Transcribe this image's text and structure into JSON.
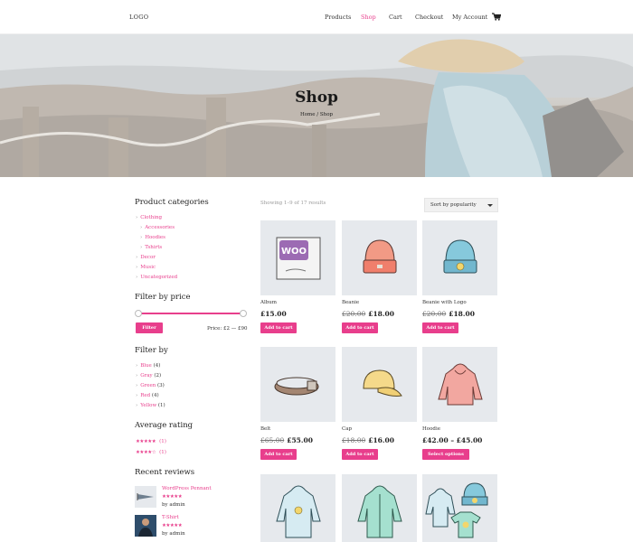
{
  "header": {
    "logo": "LOGO",
    "nav": [
      "Products",
      "Shop",
      "Cart",
      "Checkout",
      "My Account"
    ],
    "active_nav": "Shop",
    "cart_icon": "shopping-cart-icon"
  },
  "hero": {
    "title": "Shop",
    "breadcrumb": "Home / Shop"
  },
  "sidebar": {
    "categories_title": "Product categories",
    "categories": [
      {
        "label": "Clothing",
        "level": 0
      },
      {
        "label": "Accessories",
        "level": 1
      },
      {
        "label": "Hoodies",
        "level": 1
      },
      {
        "label": "Tshirts",
        "level": 1
      },
      {
        "label": "Decor",
        "level": 0
      },
      {
        "label": "Music",
        "level": 0
      },
      {
        "label": "Uncategorized",
        "level": 0
      }
    ],
    "price_title": "Filter by price",
    "filter_button": "Filter",
    "price_label": "Price:",
    "price_range": "£2 — £90",
    "filter_by_title": "Filter by",
    "colors": [
      {
        "label": "Blue",
        "count": "(4)"
      },
      {
        "label": "Gray",
        "count": "(2)"
      },
      {
        "label": "Green",
        "count": "(3)"
      },
      {
        "label": "Red",
        "count": "(4)"
      },
      {
        "label": "Yellow",
        "count": "(1)"
      }
    ],
    "rating_title": "Average rating",
    "ratings": [
      {
        "stars": "★★★★★",
        "count": "(1)"
      },
      {
        "stars": "★★★★☆",
        "count": "(1)"
      }
    ],
    "reviews_title": "Recent reviews",
    "reviews": [
      {
        "title": "WordPress Pennant",
        "stars": "★★★★★",
        "by": "by admin"
      },
      {
        "title": "T-Shirt",
        "stars": "★★★★★",
        "by": "by admin"
      }
    ]
  },
  "main": {
    "results_text": "Showing 1–9 of 17 results",
    "sort_value": "Sort by popularity",
    "products": [
      {
        "name": "Album",
        "old_price": "",
        "price": "£15.00",
        "button": "Add to cart"
      },
      {
        "name": "Beanie",
        "old_price": "£20.00",
        "price": "£18.00",
        "button": "Add to cart"
      },
      {
        "name": "Beanie with Logo",
        "old_price": "£20.00",
        "price": "£18.00",
        "button": "Add to cart"
      },
      {
        "name": "Belt",
        "old_price": "£65.00",
        "price": "£55.00",
        "button": "Add to cart"
      },
      {
        "name": "Cap",
        "old_price": "£18.00",
        "price": "£16.00",
        "button": "Add to cart"
      },
      {
        "name": "Hoodie",
        "old_price": "",
        "price": "£42.00 – £45.00",
        "button": "Select options"
      }
    ]
  },
  "colors": {
    "accent": "#e83e8c",
    "card_bg": "#e6e9ed"
  }
}
